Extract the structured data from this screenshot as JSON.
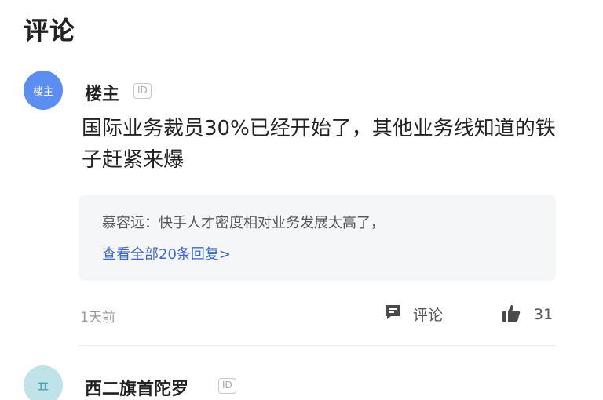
{
  "header": {
    "title": "评论"
  },
  "comments": [
    {
      "avatar_text": "楼主",
      "username": "楼主",
      "id_badge": "ID",
      "text": "国际业务裁员30%已经开始了，其他业务线知道的铁子赶紧来爆",
      "reply_preview": {
        "author": "慕容远：",
        "text": "快手人才密度相对业务发展太高了，"
      },
      "view_all_replies": "查看全部20条回复>",
      "time": "1天前",
      "comment_label": "评论",
      "like_count": "31",
      "avatar_color": "#5b8ef0"
    },
    {
      "avatar_text": "ㅍ",
      "username": "西二旗首陀罗",
      "id_badge": "ID",
      "avatar_color": "#bfe3e8"
    }
  ],
  "icons": {
    "comment": "comment-icon",
    "like": "thumbs-up-icon"
  },
  "colors": {
    "link": "#3f67c8",
    "reply_bg": "#f5f6f8"
  }
}
